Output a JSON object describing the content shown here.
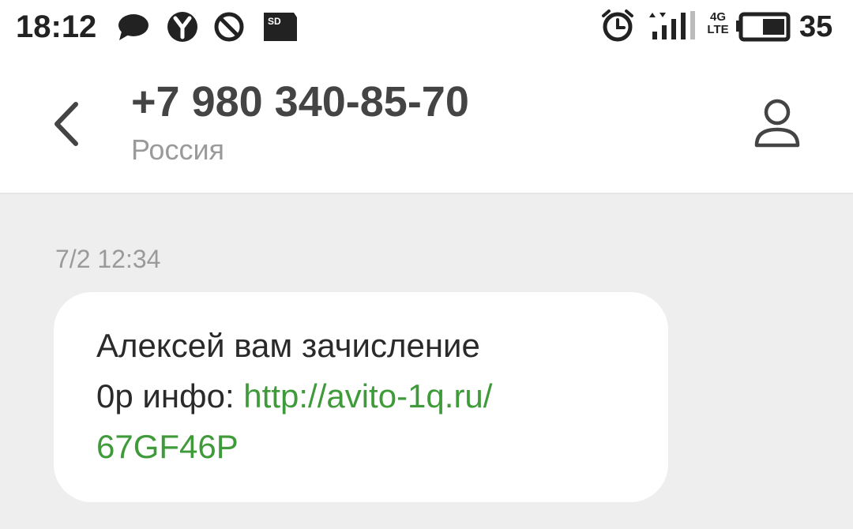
{
  "status_bar": {
    "time": "18:12",
    "battery_percent": "35",
    "network_type": "4G",
    "network_sub": "LTE",
    "left_icons": [
      "chat-bubble-icon",
      "yandex-icon",
      "do-not-disturb-icon",
      "sd-card-icon"
    ],
    "right_icons": [
      "alarm-clock-icon",
      "signal-strength-icon",
      "battery-icon"
    ],
    "sd_label": "SD"
  },
  "header": {
    "contact_number": "+7 980 340-85-70",
    "contact_country": "Россия",
    "back_icon": "chevron-left-icon",
    "contact_icon": "person-icon"
  },
  "conversation": {
    "messages": [
      {
        "timestamp": "7/2 12:34",
        "text_line1": "Алексей вам зачисление",
        "text_prefix": "0р инфо: ",
        "link_part1": "http://avito-1q.ru/",
        "link_part2": "67GF46P"
      }
    ]
  },
  "colors": {
    "link": "#3f9a3a",
    "background": "#eeeeee",
    "bubble": "#ffffff",
    "secondary_text": "#9a9a9a"
  }
}
